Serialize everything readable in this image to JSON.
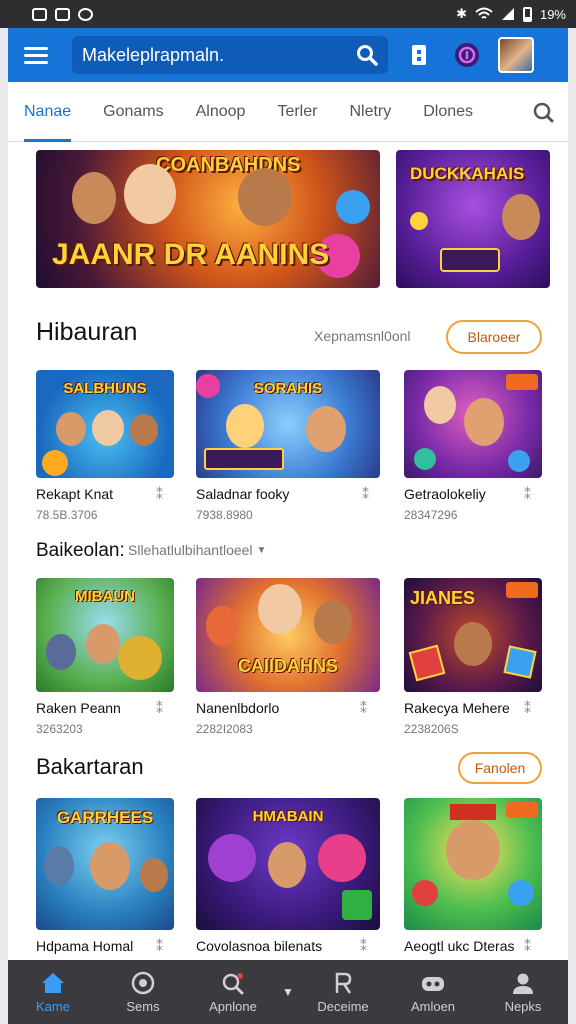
{
  "status_bar": {
    "time": "",
    "battery": "19%"
  },
  "app_bar": {
    "search_text": "Makeleplrapmaln."
  },
  "tabs": [
    {
      "label": "Nanae",
      "active": true
    },
    {
      "label": "Gonams",
      "active": false
    },
    {
      "label": "Alnoop",
      "active": false
    },
    {
      "label": "Terler",
      "active": false
    },
    {
      "label": "Nletry",
      "active": false
    },
    {
      "label": "Dlones",
      "active": false
    }
  ],
  "banners": [
    {
      "title": "JAANR DR AANINS",
      "subtitle": "COANBAHDNS"
    },
    {
      "title": "DUCKKAHAIS",
      "subtitle": ""
    }
  ],
  "sections": {
    "hiburan": {
      "title": "Hibauran",
      "sort_label": "Xepnamsnl0onl",
      "action_label": "Blaroeer",
      "cards": [
        {
          "image_title": "SALBHUNS",
          "name": "Rekapt Knat",
          "meta": "78.5B.3706"
        },
        {
          "image_title": "SORAHIS",
          "name": "Saladnar fooky",
          "meta": "7938.8980"
        },
        {
          "image_title": "",
          "name": "Getraolokeliy",
          "meta": "28347296"
        }
      ]
    },
    "baikeolan": {
      "title": "Baikeolan:",
      "dropdown_label": "Sllehatlulbihantloeel",
      "cards": [
        {
          "image_title": "MIBAUN",
          "name": "Raken Peann",
          "meta": "3263203"
        },
        {
          "image_title": "CAIIDAHNS",
          "name": "Nanenlbdorlo",
          "meta": "2282I2083"
        },
        {
          "image_title": "JIANES",
          "name": "Rakecya Mehere",
          "meta": "2238206S"
        }
      ]
    },
    "bakatan": {
      "title": "Bakartaran",
      "action_label": "Fanolen",
      "cards": [
        {
          "image_title": "GARRHEES",
          "name": "Hdpama Homal",
          "meta": ""
        },
        {
          "image_title": "HMABAIN",
          "name": "Covolasnoa bilenats",
          "meta": ""
        },
        {
          "image_title": "",
          "name": "Aeogtl ukc Dteras",
          "meta": ""
        }
      ]
    }
  },
  "bottom_nav": [
    {
      "label": "Kame",
      "icon": "home-icon",
      "active": true
    },
    {
      "label": "Sems",
      "icon": "games-icon",
      "active": false
    },
    {
      "label": "Apnlone",
      "icon": "search-icon",
      "active": false
    },
    {
      "label": "Deceime",
      "icon": "person-r-icon",
      "active": false
    },
    {
      "label": "Amloen",
      "icon": "gamepad-icon",
      "active": false
    },
    {
      "label": "Nepks",
      "icon": "user-icon",
      "active": false
    }
  ],
  "colors": {
    "primary": "#1673d8",
    "accent_orange": "#f0a23a",
    "bottom_nav_bg": "#3a3a3f",
    "active_nav": "#3b9cf5"
  }
}
